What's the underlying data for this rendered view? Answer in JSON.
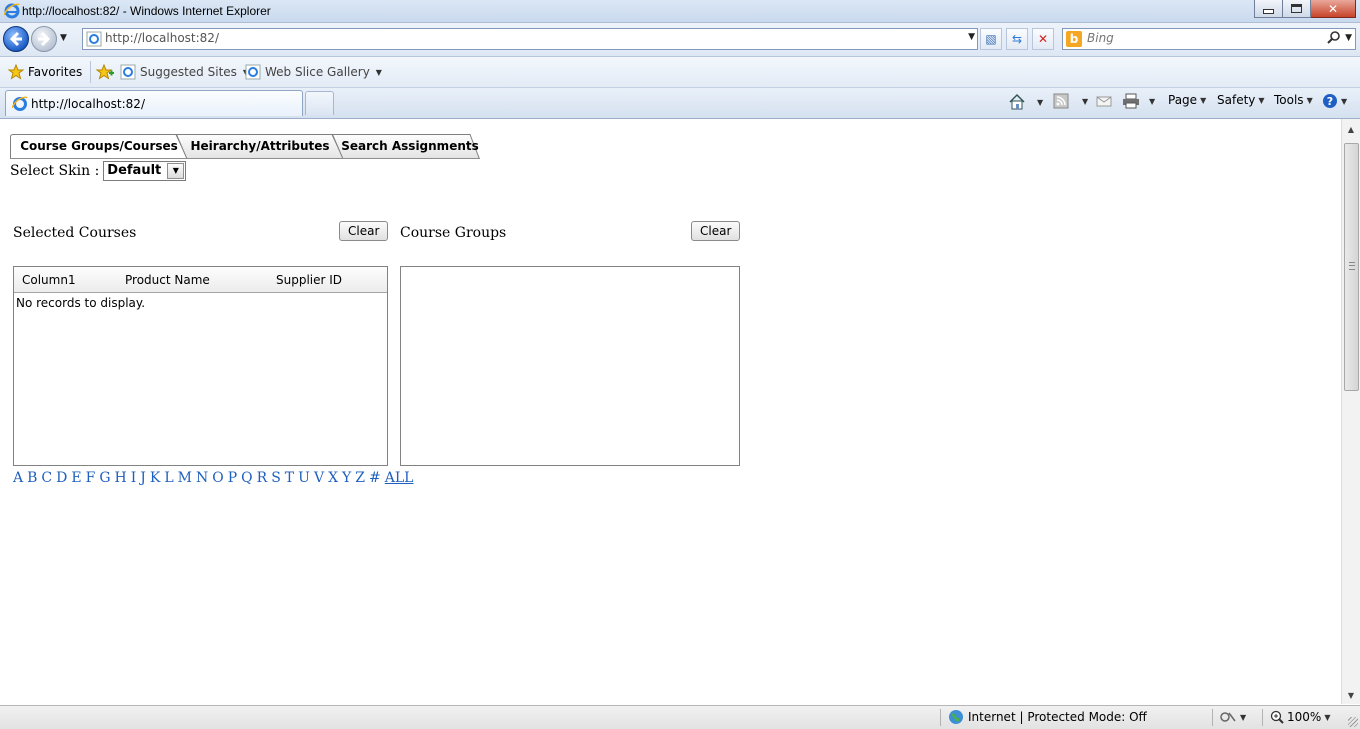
{
  "window": {
    "title": "http://localhost:82/ - Windows Internet Explorer"
  },
  "address": {
    "url": "http://localhost:82/"
  },
  "search": {
    "placeholder": "Bing"
  },
  "favorites_bar": {
    "favorites": "Favorites",
    "suggested_sites": "Suggested Sites",
    "web_slice_gallery": "Web Slice Gallery"
  },
  "browser_tab": {
    "title": "http://localhost:82/"
  },
  "command_bar": {
    "page": "Page",
    "safety": "Safety",
    "tools": "Tools"
  },
  "app": {
    "tabs": [
      "Course Groups/Courses",
      "Heirarchy/Attributes",
      "Search Assignments"
    ],
    "skin_label": "Select Skin :",
    "skin_value": "Default",
    "selected_courses": {
      "label": "Selected Courses",
      "clear": "Clear",
      "columns": [
        "Column1",
        "Product Name",
        "Supplier ID"
      ],
      "empty_text": "No records to display."
    },
    "course_groups": {
      "label": "Course Groups",
      "clear": "Clear"
    },
    "alphabet": [
      "A",
      "B",
      "C",
      "D",
      "E",
      "F",
      "G",
      "H",
      "I",
      "J",
      "K",
      "L",
      "M",
      "N",
      "O",
      "P",
      "Q",
      "R",
      "S",
      "T",
      "U",
      "V",
      "X",
      "Y",
      "Z",
      "#"
    ],
    "all_link": "ALL"
  },
  "status": {
    "zone": "Internet | Protected Mode: Off",
    "zoom": "100%"
  },
  "colors": {
    "link": "#1f5fbf",
    "titlebar": "#c9d9ee"
  }
}
